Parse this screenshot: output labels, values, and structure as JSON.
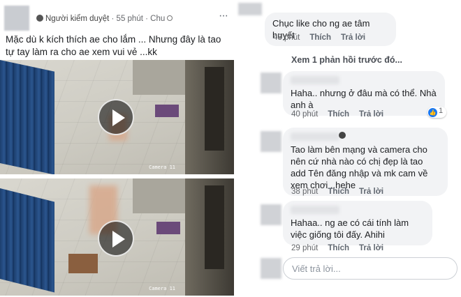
{
  "post": {
    "role": "Người kiểm duyệt",
    "time": "55 phút",
    "audience": "Chu",
    "more_label": "···",
    "text": "Mặc dù k kích thích ae cho lắm ... Nhưng đây là tao tự tay làm ra cho ae xem vui vẻ ...kk",
    "videos": [
      {
        "camera_label": "Camera 11"
      },
      {
        "camera_label": "Camera 11"
      }
    ]
  },
  "comments_top": {
    "text": "Chục like cho ng ae tâm huyết",
    "time": "43 phút",
    "like": "Thích",
    "reply": "Trả lời"
  },
  "see_previous": "Xem 1 phản hồi trước đó...",
  "replies": [
    {
      "text": "Haha.. nhưng ở đâu mà có thể. Nhà anh à",
      "time": "40 phút",
      "like": "Thích",
      "reply": "Trả lời",
      "reaction_count": "1"
    },
    {
      "text": "Tao làm bên mạng và camera cho nên cứ nhà nào có chị đẹp là tao add Tên đăng nhập và mk cam về xem chơi ..hehe",
      "time": "38 phút",
      "like": "Thích",
      "reply": "Trả lời"
    },
    {
      "text": "Hahaa.. ng ae có cái tính làm việc giống tôi đấy. Ahihi",
      "time": "29 phút",
      "like": "Thích",
      "reply": "Trả lời"
    }
  ],
  "reply_box": {
    "placeholder": "Viết trả lời..."
  },
  "colors": {
    "accent": "#1877f2",
    "bubble": "#f2f3f5"
  }
}
